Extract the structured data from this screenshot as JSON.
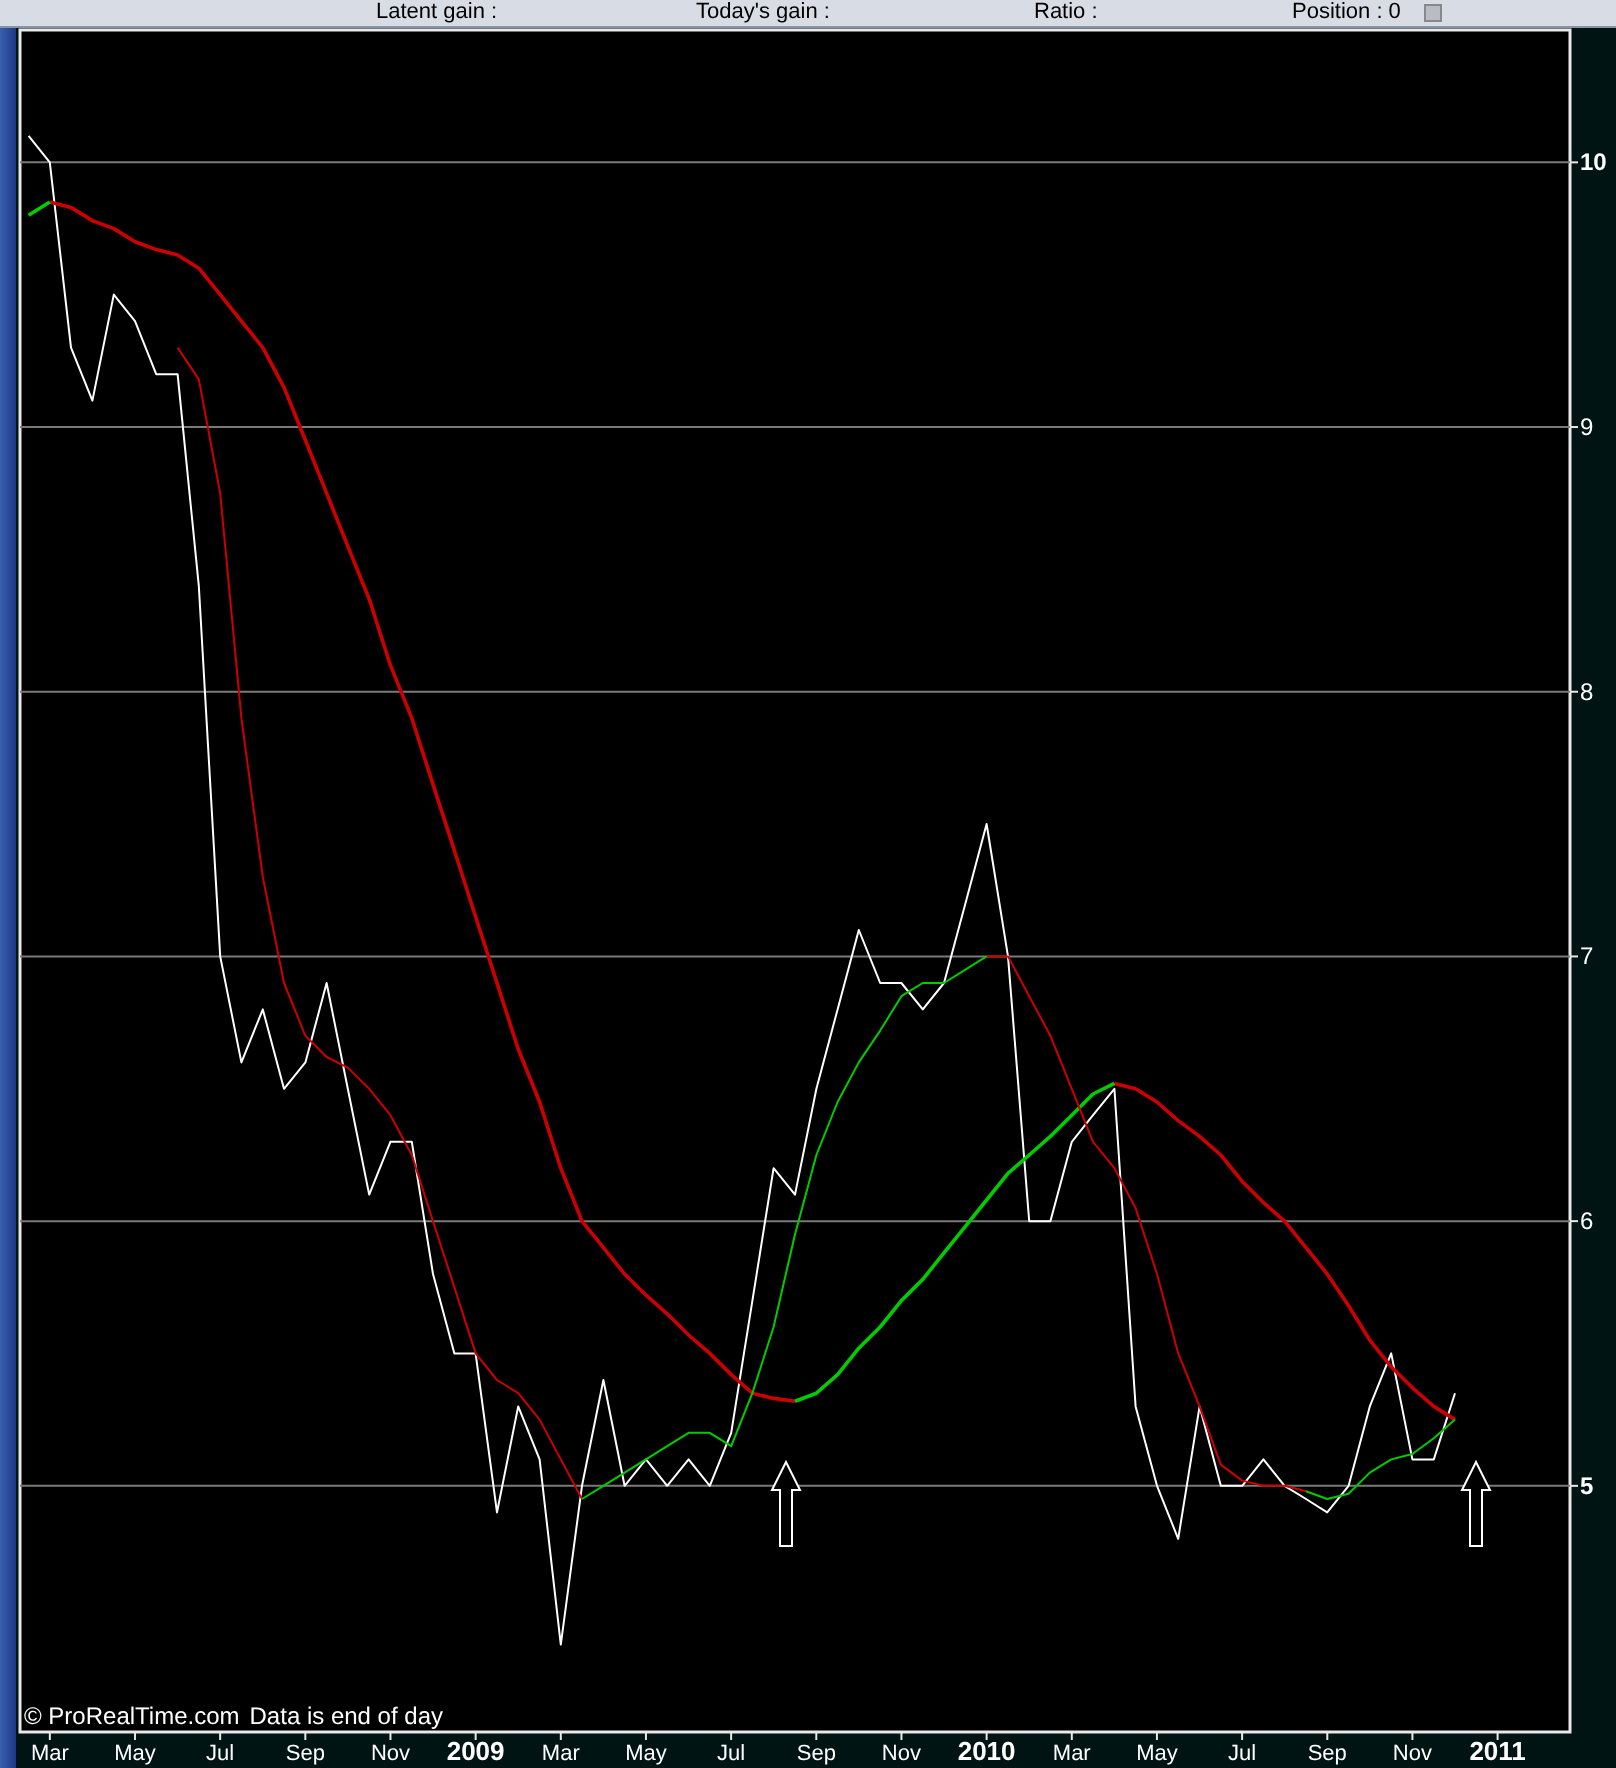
{
  "info_bar": {
    "stats": [
      "Latent gain :",
      "Today's gain :",
      "Ratio :",
      "Position : 0"
    ]
  },
  "chart": {
    "copyright": "© ProRealTime.com",
    "note": "Data is end of day",
    "chart_data": {
      "type": "line",
      "xlim": [
        2008.1083,
        2011.1417
      ],
      "ylim": [
        4.07,
        10.5
      ],
      "x": [
        2008.125,
        2008.1667,
        2008.2083,
        2008.25,
        2008.2917,
        2008.3333,
        2008.375,
        2008.4167,
        2008.4583,
        2008.5,
        2008.5417,
        2008.5833,
        2008.625,
        2008.6667,
        2008.7083,
        2008.75,
        2008.7917,
        2008.8333,
        2008.875,
        2008.9167,
        2008.9583,
        2009.0,
        2009.0417,
        2009.0833,
        2009.125,
        2009.1667,
        2009.2083,
        2009.25,
        2009.2917,
        2009.3333,
        2009.375,
        2009.4167,
        2009.4583,
        2009.5,
        2009.5417,
        2009.5833,
        2009.625,
        2009.6667,
        2009.7083,
        2009.75,
        2009.7917,
        2009.8333,
        2009.875,
        2009.9167,
        2009.9583,
        2010.0,
        2010.0417,
        2010.0833,
        2010.125,
        2010.1667,
        2010.2083,
        2010.25,
        2010.2917,
        2010.3333,
        2010.375,
        2010.4167,
        2010.4583,
        2010.5,
        2010.5417,
        2010.5833,
        2010.625,
        2010.6667,
        2010.7083,
        2010.75,
        2010.7917,
        2010.8333,
        2010.875,
        2010.9167
      ],
      "series": [
        {
          "color": "#ffffff",
          "values": [
            10.1,
            10.0,
            9.3,
            9.1,
            9.5,
            9.4,
            9.2,
            9.2,
            8.4,
            7.0,
            6.6,
            6.8,
            6.5,
            6.6,
            6.9,
            6.5,
            6.1,
            6.3,
            6.3,
            5.8,
            5.5,
            5.5,
            4.9,
            5.3,
            5.1,
            4.4,
            5.0,
            5.4,
            5.0,
            5.1,
            5.0,
            5.1,
            5.0,
            5.2,
            5.7,
            6.2,
            6.1,
            6.5,
            6.8,
            7.1,
            6.9,
            6.9,
            6.8,
            6.9,
            7.2,
            7.5,
            7.0,
            6.0,
            6.0,
            6.3,
            6.4,
            6.5,
            5.3,
            5.0,
            4.8,
            5.3,
            5.0,
            5.0,
            5.1,
            5.0,
            4.95,
            4.9,
            5.0,
            5.3,
            5.5,
            5.1,
            5.1,
            5.35
          ]
        },
        {
          "color": "#cc0000",
          "values": [
            null,
            9.85,
            9.83,
            9.78,
            9.75,
            9.7,
            9.67,
            9.65,
            9.6,
            9.5,
            9.4,
            9.3,
            9.15,
            8.95,
            8.75,
            8.55,
            8.35,
            8.1,
            7.9,
            7.65,
            7.4,
            7.15,
            6.9,
            6.65,
            6.45,
            6.2,
            6.0,
            5.9,
            5.8,
            5.72,
            5.65,
            5.57,
            5.5,
            5.42,
            5.35,
            5.33,
            5.32,
            null,
            null,
            null,
            null,
            null,
            null,
            null,
            null,
            null,
            null,
            null,
            null,
            null,
            null,
            6.52,
            6.5,
            6.45,
            6.38,
            6.32,
            6.25,
            6.15,
            6.07,
            6.0,
            5.9,
            5.8,
            5.68,
            5.55,
            5.45,
            5.37,
            5.3,
            5.25
          ]
        },
        {
          "color": "#00cc00",
          "values": [
            9.8,
            9.85,
            null,
            null,
            null,
            null,
            null,
            null,
            null,
            null,
            null,
            null,
            null,
            null,
            null,
            null,
            null,
            null,
            null,
            null,
            null,
            null,
            null,
            null,
            null,
            null,
            null,
            null,
            null,
            null,
            null,
            null,
            null,
            null,
            null,
            null,
            5.32,
            5.35,
            5.42,
            5.52,
            5.6,
            5.7,
            5.78,
            5.88,
            5.98,
            6.08,
            6.18,
            6.25,
            6.32,
            6.4,
            6.48,
            6.52,
            null,
            null,
            null,
            null,
            null,
            null,
            null,
            null,
            null,
            null,
            null,
            null,
            null,
            null,
            null,
            null
          ]
        },
        {
          "color": "#cc0000",
          "values": [
            null,
            null,
            null,
            null,
            null,
            null,
            null,
            9.3,
            9.18,
            8.75,
            7.9,
            7.3,
            6.9,
            6.7,
            6.62,
            6.58,
            6.5,
            6.4,
            6.25,
            6.0,
            5.75,
            5.5,
            5.4,
            5.35,
            5.25,
            5.1,
            4.95,
            null,
            null,
            null,
            null,
            null,
            null,
            null,
            null,
            null,
            null,
            null,
            null,
            null,
            null,
            null,
            null,
            null,
            null,
            7.0,
            7.0,
            6.85,
            6.7,
            6.5,
            6.3,
            6.2,
            6.05,
            5.8,
            5.5,
            5.3,
            5.08,
            5.02,
            5.0,
            5.0,
            4.98,
            null,
            null,
            null,
            null,
            null,
            null,
            null
          ]
        },
        {
          "color": "#00cc00",
          "values": [
            null,
            null,
            null,
            null,
            null,
            null,
            null,
            null,
            null,
            null,
            null,
            null,
            null,
            null,
            null,
            null,
            null,
            null,
            null,
            null,
            null,
            null,
            null,
            null,
            null,
            null,
            4.95,
            5.0,
            5.05,
            5.1,
            5.15,
            5.2,
            5.2,
            5.15,
            5.35,
            5.6,
            5.95,
            6.25,
            6.45,
            6.6,
            6.72,
            6.85,
            6.9,
            6.9,
            6.95,
            7.0,
            null,
            null,
            null,
            null,
            null,
            null,
            null,
            null,
            null,
            null,
            null,
            null,
            null,
            null,
            4.98,
            4.95,
            4.97,
            5.05,
            5.1,
            5.12,
            5.18,
            5.25
          ]
        }
      ],
      "xticks": [
        {
          "value": 2008.1667,
          "label": "Mar"
        },
        {
          "value": 2008.3333,
          "label": "May"
        },
        {
          "value": 2008.5,
          "label": "Jul"
        },
        {
          "value": 2008.6667,
          "label": "Sep"
        },
        {
          "value": 2008.8333,
          "label": "Nov"
        },
        2009,
        {
          "value": 2009.1667,
          "label": "Mar"
        },
        {
          "value": 2009.3333,
          "label": "May"
        },
        {
          "value": 2009.5,
          "label": "Jul"
        },
        {
          "value": 2009.6667,
          "label": "Sep"
        },
        {
          "value": 2009.8333,
          "label": "Nov"
        },
        2010,
        {
          "value": 2010.1667,
          "label": "Mar"
        },
        {
          "value": 2010.3333,
          "label": "May"
        },
        {
          "value": 2010.5,
          "label": "Jul"
        },
        {
          "value": 2010.6667,
          "label": "Sep"
        },
        {
          "value": 2010.8333,
          "label": "Nov"
        },
        2011
      ],
      "yticks": [
        5,
        6,
        7,
        8,
        9,
        10
      ],
      "grid": true
    },
    "signals": [
      {
        "kind": "up-arrow"
      },
      {
        "kind": "up-arrow"
      }
    ]
  }
}
